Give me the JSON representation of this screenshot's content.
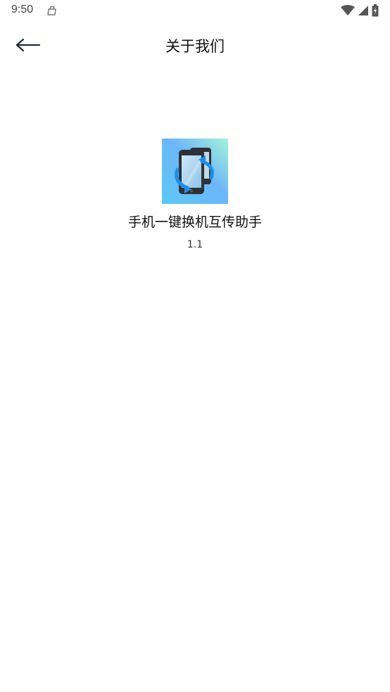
{
  "status_bar": {
    "time": "9:50",
    "icons": [
      "notification-bag-icon",
      "wifi-icon",
      "cellular-signal-icon",
      "battery-charging-icon"
    ]
  },
  "header": {
    "title": "关于我们",
    "back_icon": "arrow-left-icon"
  },
  "app": {
    "name": "手机一键换机互传助手",
    "version": "1.1",
    "icon": "phone-transfer-icon",
    "icon_colors": {
      "gradient_start": "#5EC8F5",
      "gradient_end": "#A6F3D9",
      "arrow": "#1E8FE8"
    }
  }
}
